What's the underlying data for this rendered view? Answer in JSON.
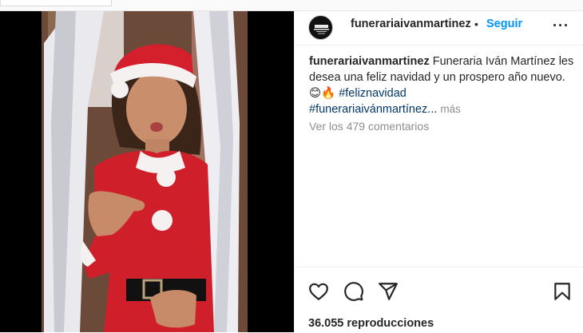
{
  "post": {
    "account": {
      "username": "funerariaivanmartinez",
      "avatar_icon": "funeral-home-logo-icon",
      "follow_label": "Seguir",
      "separator": "•"
    },
    "caption": {
      "username": "funerariaivanmartinez",
      "text": "Funeraria Iván Martínez les desea una feliz navidad y un prospero año nuevo.",
      "emojis": "😊🔥",
      "hashtag_1": "#feliznavidad",
      "hashtag_2": "#funerariaivánmartínez...",
      "more_label": "más"
    },
    "comments_label": "Ver los 479 comentarios",
    "actions": {
      "like_icon": "heart-icon",
      "comment_icon": "comment-icon",
      "share_icon": "paper-plane-icon",
      "save_icon": "bookmark-icon"
    },
    "views_label": "36.055 reproducciones"
  },
  "colors": {
    "accent": "#0095f6",
    "hashtag": "#00376b",
    "muted": "#8e8e8e",
    "text": "#262626"
  }
}
